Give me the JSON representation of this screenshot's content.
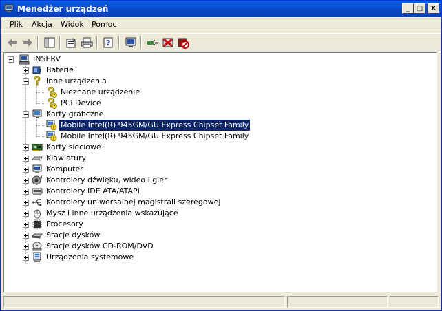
{
  "window": {
    "title": "Menedżer urządzeń",
    "minimize_glyph": "_",
    "maximize_glyph": "□",
    "close_glyph": "X"
  },
  "menu": [
    {
      "label": "Plik"
    },
    {
      "label": "Akcja"
    },
    {
      "label": "Widok"
    },
    {
      "label": "Pomoc"
    }
  ],
  "toolbar_icons": [
    "back-icon",
    "forward-icon",
    "console-tree-icon",
    "properties-icon",
    "print-icon",
    "help-icon",
    "scan-hardware-icon",
    "update-driver-icon",
    "uninstall-icon",
    "disable-icon"
  ],
  "tree": {
    "root": {
      "label": "INSERV",
      "icon": "computer-icon"
    },
    "items": [
      {
        "label": "Baterie",
        "icon": "battery-icon",
        "expanded": false
      },
      {
        "label": "Inne urządzenia",
        "icon": "unknown-device-icon",
        "expanded": true,
        "children": [
          {
            "label": "Nieznane urządzenie",
            "icon": "unknown-device-icon"
          },
          {
            "label": "PCI Device",
            "icon": "unknown-device-icon"
          }
        ]
      },
      {
        "label": "Karty graficzne",
        "icon": "display-adapter-icon",
        "expanded": true,
        "children": [
          {
            "label": "Mobile Intel(R) 945GM/GU Express Chipset Family",
            "icon": "display-warning-icon",
            "selected": true
          },
          {
            "label": "Mobile Intel(R) 945GM/GU Express Chipset Family",
            "icon": "display-warning-icon"
          }
        ]
      },
      {
        "label": "Karty sieciowe",
        "icon": "network-adapter-icon",
        "expanded": false
      },
      {
        "label": "Klawiatury",
        "icon": "keyboard-icon",
        "expanded": false
      },
      {
        "label": "Komputer",
        "icon": "computer-icon",
        "expanded": false
      },
      {
        "label": "Kontrolery dźwięku, wideo i gier",
        "icon": "sound-icon",
        "expanded": false
      },
      {
        "label": "Kontrolery IDE ATA/ATAPI",
        "icon": "ide-controller-icon",
        "expanded": false
      },
      {
        "label": "Kontrolery uniwersalnej magistrali szeregowej",
        "icon": "usb-icon",
        "expanded": false
      },
      {
        "label": "Mysz i inne urządzenia wskazujące",
        "icon": "mouse-icon",
        "expanded": false
      },
      {
        "label": "Procesory",
        "icon": "processor-icon",
        "expanded": false
      },
      {
        "label": "Stacje dysków",
        "icon": "disk-drive-icon",
        "expanded": false
      },
      {
        "label": "Stacje dysków CD-ROM/DVD",
        "icon": "cdrom-icon",
        "expanded": false
      },
      {
        "label": "Urządzenia systemowe",
        "icon": "system-devices-icon",
        "expanded": false
      }
    ]
  },
  "colors": {
    "titlebar": "#0a46c4",
    "selection": "#0a246a",
    "window_bg": "#ece9d8",
    "warning": "#ffd800"
  }
}
